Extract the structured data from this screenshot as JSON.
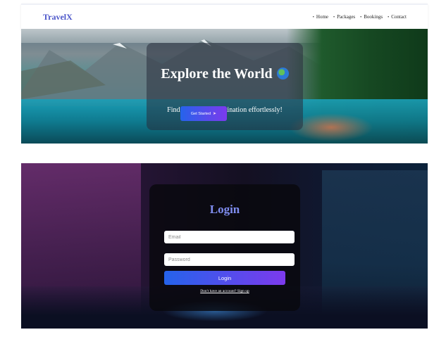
{
  "nav": {
    "brand": "TravelX",
    "links": [
      "Home",
      "Packages",
      "Bookings",
      "Contact"
    ],
    "bullet": "•"
  },
  "hero": {
    "title": "Explore the World",
    "subtitle": "Find your dream destination effortlessly!",
    "cta_label": "Get Started",
    "cta_icon": "rocket-icon",
    "title_icon": "globe-icon"
  },
  "login": {
    "title": "Login",
    "email_placeholder": "Email",
    "password_placeholder": "Password",
    "button_label": "Login",
    "signup_text": "Don't have an account? Sign up"
  },
  "colors": {
    "brand": "#4b55c9",
    "accent_start": "#2563eb",
    "accent_end": "#7c3aed",
    "login_title": "#7f8df0"
  }
}
